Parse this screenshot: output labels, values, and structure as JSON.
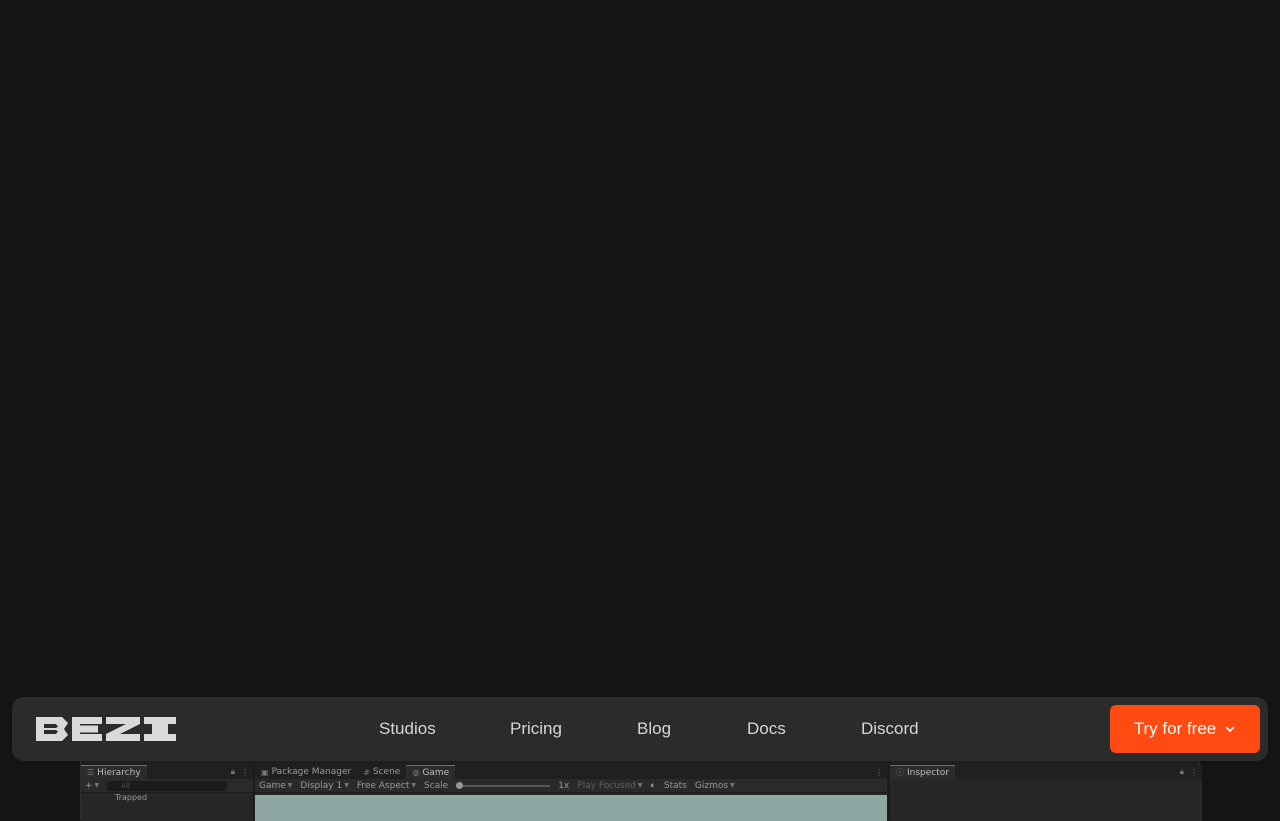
{
  "brand": {
    "logo_text": "BEZI",
    "logo_color": "#d9d9d9"
  },
  "nav": {
    "links": [
      "Studios",
      "Pricing",
      "Blog",
      "Docs",
      "Discord"
    ],
    "cta_label": "Try for free",
    "cta_color": "#ff4a12"
  },
  "editor": {
    "hierarchy": {
      "tab": "Hierarchy",
      "search_placeholder": "All",
      "item": "Trapped"
    },
    "center_tabs": [
      "Package Manager",
      "Scene",
      "Game"
    ],
    "game_toolbar": {
      "mode": "Game",
      "display": "Display 1",
      "aspect": "Free Aspect",
      "scale_label": "Scale",
      "scale_value": "1x",
      "play_mode": "Play Focused",
      "stats": "Stats",
      "gizmos": "Gizmos"
    },
    "inspector": {
      "tab": "Inspector"
    }
  },
  "colors": {
    "page_bg": "#141415",
    "nav_bg": "#2b2b2b"
  }
}
